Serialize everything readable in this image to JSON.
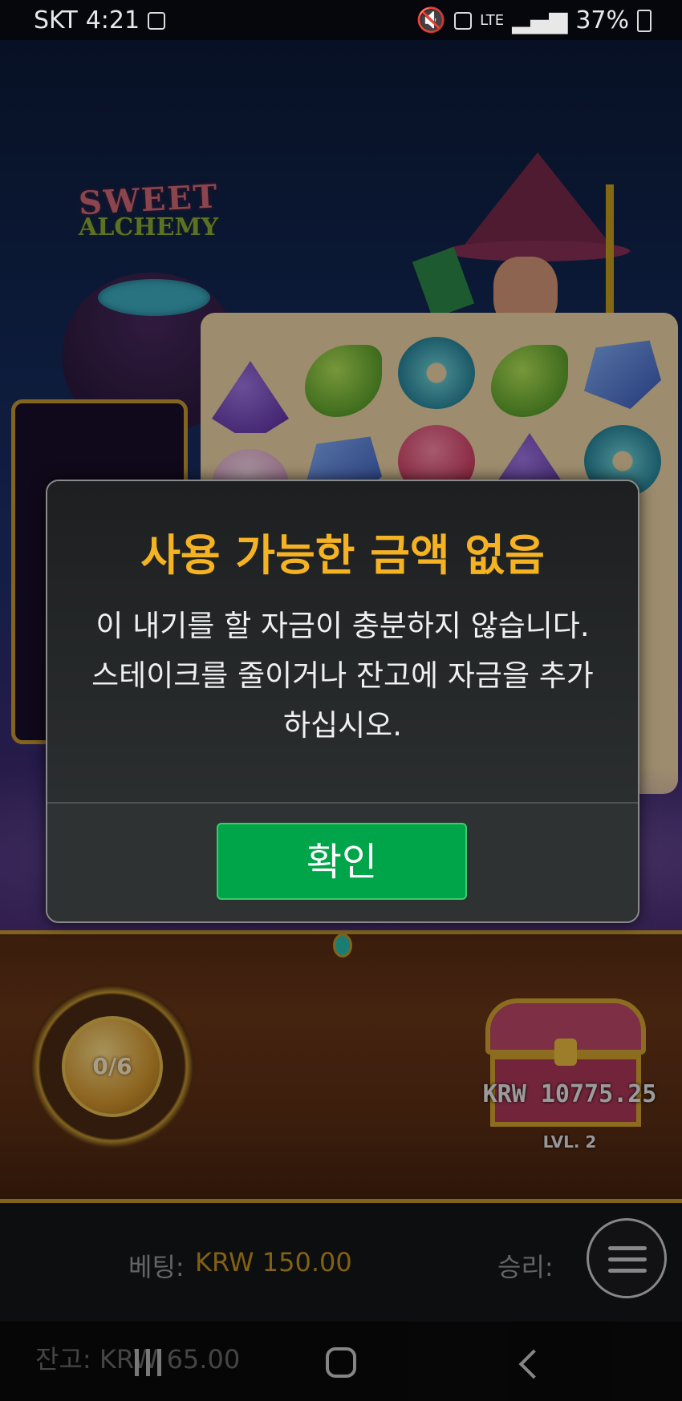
{
  "status_bar": {
    "carrier": "SKT",
    "time": "4:21",
    "network": "LTE",
    "battery": "37%"
  },
  "game": {
    "logo_line1": "SWEET",
    "logo_line2": "ALCHEMY",
    "gems": [
      "purple",
      "green",
      "teal",
      "green",
      "blue",
      "purple",
      "blue",
      "red",
      "purple",
      "teal",
      "pink"
    ],
    "meter_count": "0/6",
    "chest_amount": "KRW 10775.25",
    "chest_level": "LVL. 2"
  },
  "dialog": {
    "title": "사용 가능한 금액 없음",
    "message": "이 내기를 할 자금이 충분하지 않습니다. 스테이크를 줄이거나 잔고에 자금을 추가하십시오.",
    "ok_label": "확인"
  },
  "bottom_bar": {
    "bet_label": "베팅:",
    "bet_value": "KRW 150.00",
    "win_label": "승리:",
    "balance_text": "잔고: KRW 65.00"
  },
  "colors": {
    "title": "#f5b323",
    "ok_button": "#00a549",
    "bet_value": "#c8961e"
  }
}
